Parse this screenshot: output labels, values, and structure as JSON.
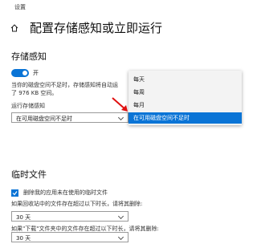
{
  "window": {
    "title": "设置"
  },
  "header": {
    "title": "配置存储感知或立即运行"
  },
  "storage_sense": {
    "heading": "存储感知",
    "toggle_label": "开",
    "toggle_on": true,
    "description_line1": "当你的磁盘空间不足时，存储感知将自动运",
    "description_line2": "了 976 KB 空间。",
    "run_label": "运行存储感知",
    "run_value": "在可用磁盘空间不足时",
    "dropdown_options": [
      "每天",
      "每周",
      "每月",
      "在可用磁盘空间不足时"
    ],
    "dropdown_selected": "在可用磁盘空间不足时"
  },
  "temp_files": {
    "heading": "临时文件",
    "checkbox_label": "删除我的应用未在使用的临时文件",
    "checkbox_checked": true,
    "recycle_label": "如果回收站中的文件存在超过以下时长，请将其删除:",
    "recycle_value": "30 天",
    "downloads_label": "如果\"下载\"文件夹中的文件存在超过以下时长，请将其删除:",
    "downloads_value": "30 天"
  },
  "colors": {
    "accent": "#0a74d6",
    "arrow": "#e01010"
  }
}
